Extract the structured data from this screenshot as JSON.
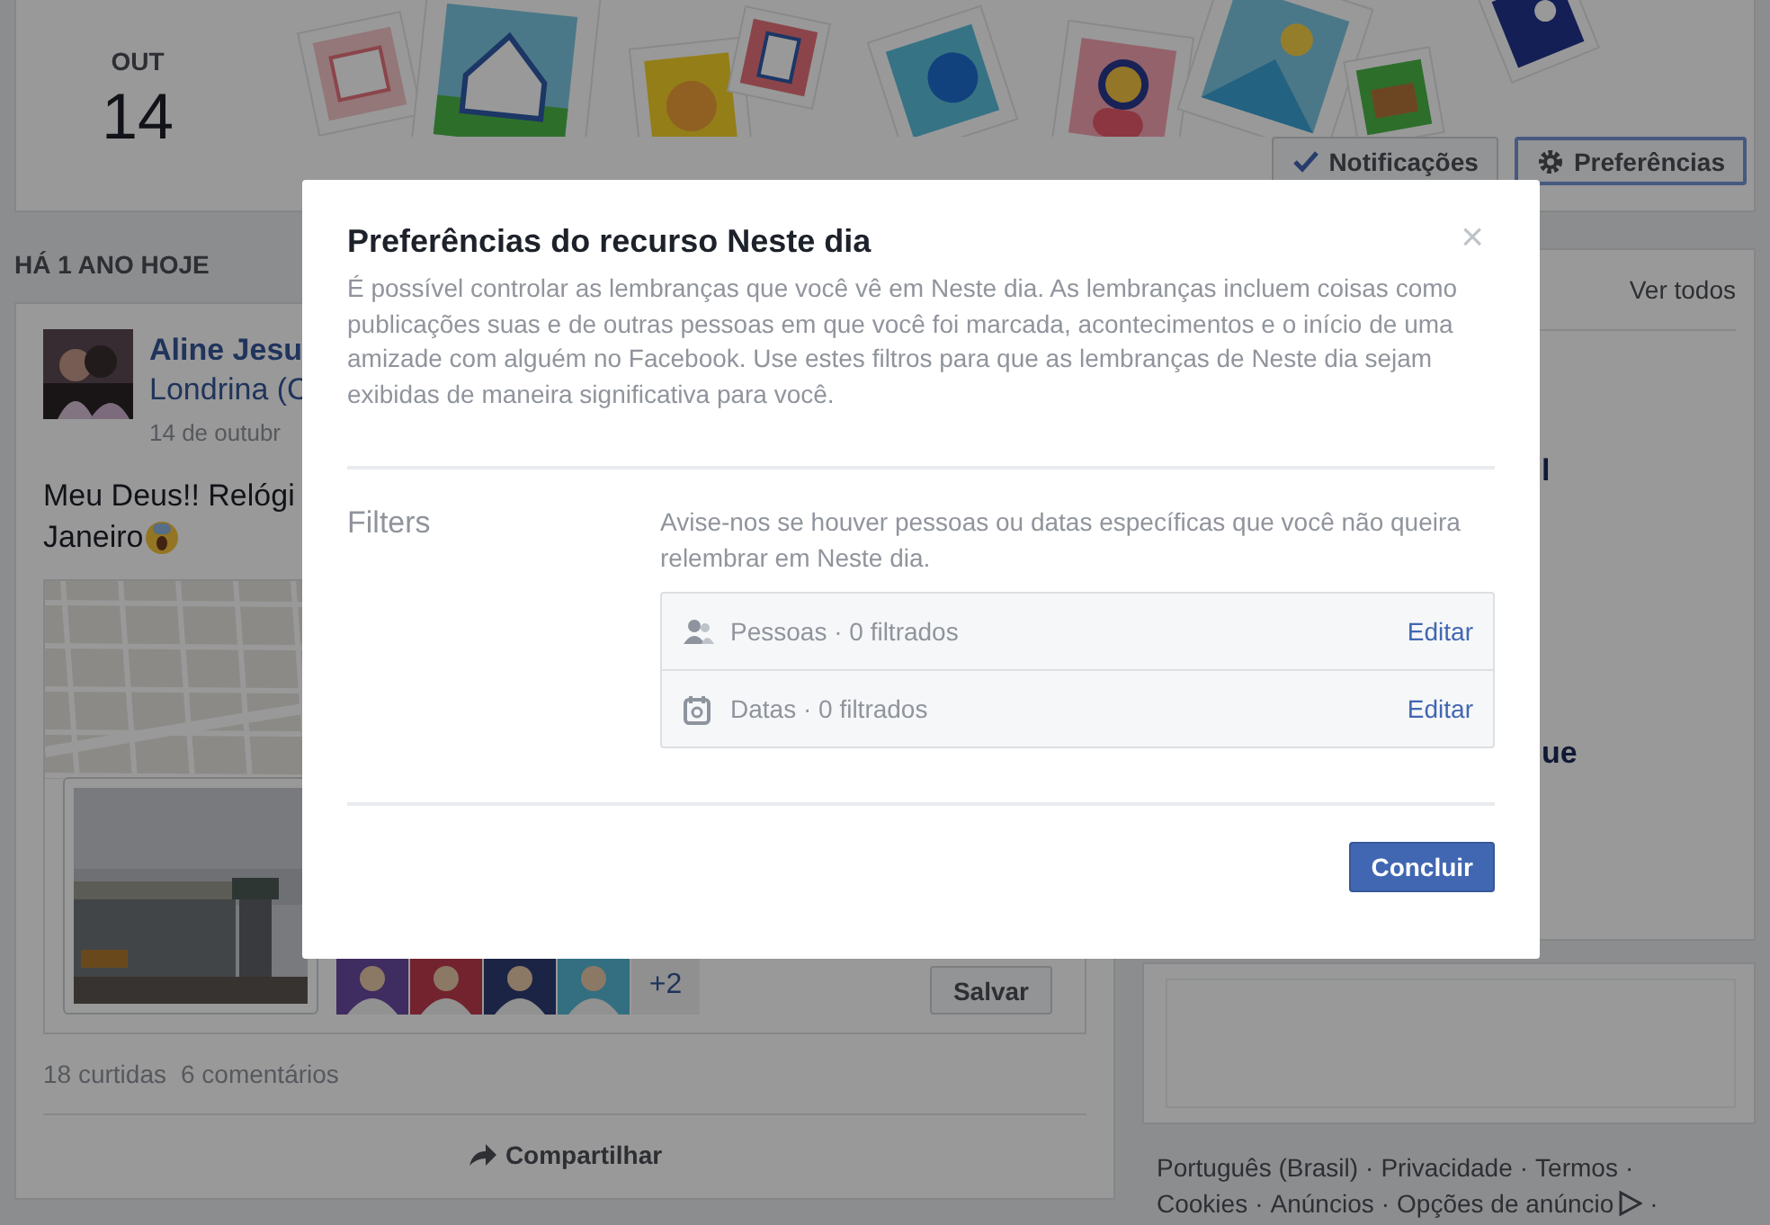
{
  "header": {
    "month": "OUT",
    "day": "14",
    "buttons": [
      {
        "label": "Notificações",
        "focused": false
      },
      {
        "label": "Preferências",
        "focused": true
      }
    ]
  },
  "memories": {
    "heading": "HÁ 1 ANO HOJE",
    "post": {
      "author": "Aline Jesu",
      "place": "Londrina (C",
      "date": "14 de outubr",
      "text_lines": [
        "Meu Deus!! Relógi",
        "Janeiro"
      ],
      "friends_more": "+2",
      "save": "Salvar",
      "likes": "18 curtidas",
      "comments": "6 comentários",
      "share": "Compartilhar"
    }
  },
  "sidebar": {
    "link": "Ver todos",
    "fragments": [
      "l",
      "ue"
    ]
  },
  "footer": {
    "separator": "·",
    "lines": [
      [
        "Português (Brasil)",
        "Privacidade",
        "Termos"
      ],
      [
        "Cookies",
        "Anúncios",
        "Opções de anúncio"
      ]
    ]
  },
  "dialog": {
    "title": "Preferências do recurso Neste dia",
    "close": "×",
    "description": "É possível controlar as lembranças que você vê em Neste dia. As lembranças incluem coisas como publicações suas e de outras pessoas em que você foi marcada, acontecimentos e o início de uma amizade com alguém no Facebook. Use estes filtros para que as lembranças de Neste dia sejam exibidas de maneira significativa para você.",
    "filters_label": "Filters",
    "filters_hint": "Avise-nos se houver pessoas ou datas específicas que você não queira relembrar em Neste dia.",
    "rows": [
      {
        "label": "Pessoas · 0 filtrados",
        "action": "Editar"
      },
      {
        "label": "Datas · 0 filtrados",
        "action": "Editar"
      }
    ],
    "button": "Concluir"
  }
}
